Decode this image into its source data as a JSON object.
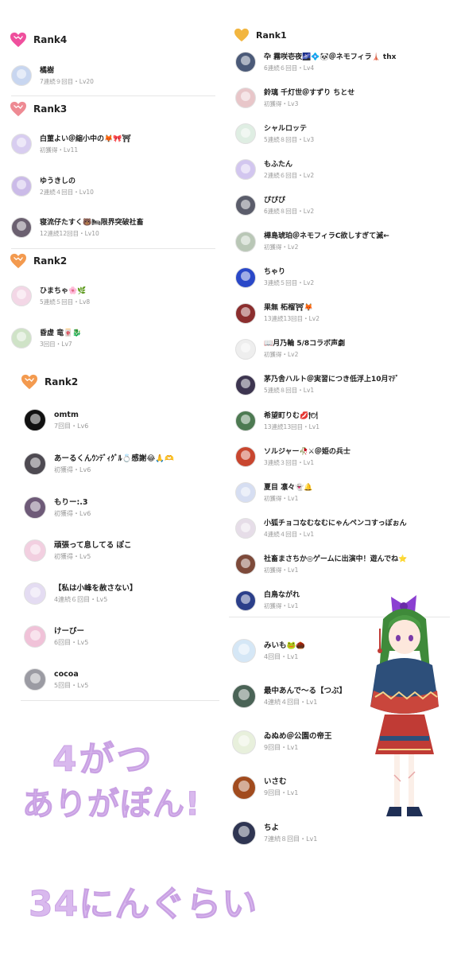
{
  "screen": {
    "top_left": {
      "rank4_label": "Rank4",
      "rank3_label": "Rank3",
      "rank2_label": "Rank2",
      "rank4": [
        {
          "name": "橘樹",
          "sub": "7連続９回目・Lv20",
          "color": "#c8d6f0"
        }
      ],
      "rank3": [
        {
          "name": "白菫よい＠縮小中の🦊🎀⛩",
          "sub": "初獲得・Lv11",
          "color": "#d8cdf0"
        },
        {
          "name": "ゆうきしの",
          "sub": "2連続４回目・Lv10",
          "color": "#cbbbe8"
        },
        {
          "name": "寝流仔たすく🐻🛏限界突破社畜",
          "sub": "12連続12回目・Lv10",
          "color": "#6b6070"
        }
      ],
      "rank2": [
        {
          "name": "ひまちゃ🌸🌿",
          "sub": "5連続５回目・Lv8",
          "color": "#f3d7e6"
        },
        {
          "name": "昏虚 竜🀄🐉",
          "sub": "3回目・Lv7",
          "color": "#cfe3c7"
        }
      ]
    },
    "bottom_left": {
      "rank2_label": "Rank2",
      "items": [
        {
          "name": "omtm",
          "sub": "7回目・Lv6",
          "color": "#111111"
        },
        {
          "name": "あーるくんｳﾝﾃﾞｨｸﾞﾙ💍感謝😂🙏🫶",
          "sub": "初獲得・Lv6",
          "color": "#4e4a52"
        },
        {
          "name": "もりー:.3",
          "sub": "初獲得・Lv6",
          "color": "#6e5a78"
        },
        {
          "name": "頑張って息してる ぽこ",
          "sub": "初獲得・Lv5",
          "color": "#f2cfe0"
        },
        {
          "name": "【私は小峰を赦さない】",
          "sub": "4連続６回目・Lv5",
          "color": "#e4dcf2"
        },
        {
          "name": "けーびー",
          "sub": "6回目・Lv5",
          "color": "#f0c2d8"
        },
        {
          "name": "cocoa",
          "sub": "5回目・Lv5",
          "color": "#9b9ba3"
        }
      ]
    },
    "right": {
      "rank1_label": "Rank1",
      "items": [
        {
          "name": "卆 霧咲壱夜🌌💠🐼＠ネモフィラ🗼 thx",
          "sub": "6連続６回目・Lv4",
          "color": "#4b5a78"
        },
        {
          "name": "鈴璃 千灯世＠すずり ちとせ",
          "sub": "初獲得・Lv3",
          "color": "#e8c6c9"
        },
        {
          "name": "シャルロッテ",
          "sub": "5連続８回目・Lv3",
          "color": "#dfeee3"
        },
        {
          "name": "もふたん",
          "sub": "2連続６回目・Lv2",
          "color": "#d2c6ef"
        },
        {
          "name": "ぴぴぴ",
          "sub": "6連続８回目・Lv2",
          "color": "#5b5d6b"
        },
        {
          "name": "樺島琥珀＠ネモフィラC欲しすぎて滅←",
          "sub": "初獲得・Lv2",
          "color": "#b9c7b6"
        },
        {
          "name": "ちゃり",
          "sub": "3連続５回目・Lv2",
          "color": "#2a48c8"
        },
        {
          "name": "果無 柘榴⛩🦊",
          "sub": "13連続13回目・Lv2",
          "color": "#8b2e2e"
        },
        {
          "name": "📖月乃輪 5/8コラボ声劇",
          "sub": "初獲得・Lv2",
          "color": "#eeeeee"
        },
        {
          "name": "茅乃舎ハルト＠実習につき低浮上10月ﾏﾃﾞ",
          "sub": "5連続８回目・Lv1",
          "color": "#3d3550"
        },
        {
          "name": "希望町りむ💋🍽",
          "sub": "13連続13回目・Lv1",
          "color": "#4d7a52"
        },
        {
          "name": "ソルジャー🥀⚔＠姫の兵士",
          "sub": "3連続３回目・Lv1",
          "color": "#c8462f"
        },
        {
          "name": "夏目 凛々👻🔔",
          "sub": "初獲得・Lv1",
          "color": "#d6def2"
        },
        {
          "name": "小狐チョコなむなむにゃんペンコすっぽぉん",
          "sub": "4連続４回目・Lv1",
          "color": "#e6dde8"
        },
        {
          "name": "社畜まさちか◎ゲームに出演中！遊んでね⭐",
          "sub": "初獲得・Lv1",
          "color": "#7d4a3a"
        },
        {
          "name": "白鳥ながれ",
          "sub": "初獲得・Lv1",
          "color": "#2b3f8a"
        }
      ],
      "items2": [
        {
          "name": "みいも🐸🌰",
          "sub": "4回目・Lv1",
          "color": "#d5e7f6"
        },
        {
          "name": "最中あんで〜る【つぶ】",
          "sub": "4連続４回目・Lv1",
          "color": "#4a6356"
        },
        {
          "name": "ゐぬめ＠公園の帝王",
          "sub": "9回目・Lv1",
          "color": "#e8f0dc"
        },
        {
          "name": "いさむ",
          "sub": "9回目・Lv1",
          "color": "#a14b1e"
        },
        {
          "name": "ちよ",
          "sub": "7連続８回目・Lv1",
          "color": "#2f3552"
        }
      ]
    },
    "banner": {
      "line1": "4がつ",
      "line2": "ありがぽん!",
      "line3": "34にんぐらい"
    },
    "colors": {
      "heart_pink": "#ef4f9d",
      "heart_rose": "#ee8a93",
      "heart_orange": "#f39a4f",
      "heart_gold": "#f2b640",
      "banner": "#d9b9ee"
    }
  }
}
